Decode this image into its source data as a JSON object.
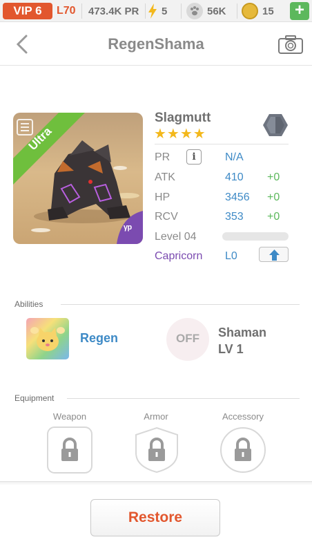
{
  "topbar": {
    "vip": "VIP 6",
    "level": "L70",
    "power": "473.4K PR",
    "energy": "5",
    "pets": "56K",
    "coins": "15",
    "add": "+"
  },
  "header": {
    "title": "RegenShama"
  },
  "pet": {
    "name": "Slagmutt",
    "stars": "★★★★",
    "rarity": "Ultra",
    "stats": [
      {
        "label": "PR",
        "value": "N/A",
        "bonus": ""
      },
      {
        "label": "ATK",
        "value": "410",
        "bonus": "+0"
      },
      {
        "label": "HP",
        "value": "3456",
        "bonus": "+0"
      },
      {
        "label": "RCV",
        "value": "353",
        "bonus": "+0"
      }
    ],
    "level": "Level 04",
    "level_progress": 0.0,
    "zodiac": "Capricorn",
    "zodiac_level": "L0"
  },
  "abilities": {
    "title": "Abilities",
    "ability1": "Regen",
    "off_label": "OFF",
    "ability2_name": "Shaman",
    "ability2_level": "LV 1"
  },
  "equipment": {
    "title": "Equipment",
    "slots": [
      "Weapon",
      "Armor",
      "Accessory"
    ]
  },
  "footer": {
    "restore": "Restore"
  },
  "colors": {
    "accent": "#e2572e",
    "blue": "#3e8ac6",
    "green": "#5cb85c",
    "purple": "#7b4bb0",
    "star": "#f3b81c"
  }
}
